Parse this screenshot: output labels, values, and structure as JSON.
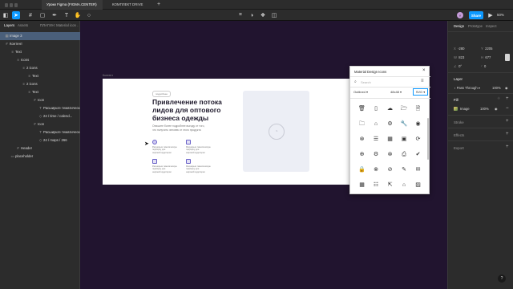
{
  "tabs": {
    "home_icon": "home-icon",
    "tab1": "Уроки Figma (FIGMA.CENTER)",
    "tab2": "КОМПЛЕКТ DRIVE",
    "add": "+"
  },
  "toolbar": {
    "share": "Share",
    "zoom": "50%",
    "avatar": "Y",
    "play_icon": "play-icon"
  },
  "left_panel": {
    "tab_layers": "Layers",
    "tab_assets": "Assets",
    "tab_page": "ПЛАГИН: Material icon ...",
    "layers": [
      {
        "label": "Image 3",
        "indent": 0,
        "icon": "▦",
        "selected": true
      },
      {
        "label": "Контент",
        "indent": 0,
        "icon": "#",
        "selected": false
      },
      {
        "label": "Text",
        "indent": 1,
        "icon": "≡",
        "selected": false
      },
      {
        "label": "Icons",
        "indent": 2,
        "icon": "≡",
        "selected": false
      },
      {
        "label": "2 icons",
        "indent": 3,
        "icon": "≡",
        "selected": false
      },
      {
        "label": "Text",
        "indent": 4,
        "icon": "≡",
        "selected": false
      },
      {
        "label": "2 icons",
        "indent": 3,
        "icon": "≡",
        "selected": false
      },
      {
        "label": "Text",
        "indent": 4,
        "icon": "≡",
        "selected": false
      },
      {
        "label": "Icon",
        "indent": 5,
        "icon": "#",
        "selected": false
      },
      {
        "label": "Расширьте тематическ...",
        "indent": 6,
        "icon": "T",
        "selected": false
      },
      {
        "label": "24 / time / calend...",
        "indent": 6,
        "icon": "◇",
        "selected": false
      },
      {
        "label": "Icon",
        "indent": 5,
        "icon": "#",
        "selected": false
      },
      {
        "label": "Расширьте тематическ...",
        "indent": 6,
        "icon": "T",
        "selected": false
      },
      {
        "label": "24 / maps / 266",
        "indent": 6,
        "icon": "◇",
        "selected": false
      },
      {
        "label": "Header",
        "indent": 2,
        "icon": "#",
        "selected": false
      },
      {
        "label": "placeholder",
        "indent": 1,
        "icon": "▭",
        "selected": false
      }
    ]
  },
  "frame": {
    "label": "Контент",
    "badge": "подробнее",
    "headline_1": "Привлечение потока",
    "headline_2": "лидов для оптового",
    "headline_3": "бизнеса одежды",
    "desc_1": "Опишите более подробнее выгоду от того,",
    "desc_2": "что получить человек от этого продукта",
    "features": [
      {
        "text": "Расширьте тематическую подборку для",
        "text2": "широкой аудитории"
      },
      {
        "text": "Расширьте тематическую подборку для",
        "text2": "широкой аудитории"
      },
      {
        "text": "Расширьте тематическую подборку для",
        "text2": "широкой аудитории"
      },
      {
        "text": "Расширьте тематическую подборку для",
        "text2": "широкой аудитории"
      }
    ]
  },
  "plugin": {
    "title": "Material Design Icons",
    "search_placeholder": "Search",
    "style": "Outlined",
    "size": "48x48",
    "format": "SVG",
    "icons": [
      [
        "delete",
        "phone-iphone",
        "cloud-upload",
        "folder-open",
        "description"
      ],
      [
        "folder",
        "home",
        "settings",
        "build",
        "album"
      ],
      [
        "cancel",
        "view-agenda",
        "domain",
        "payments",
        "cached"
      ],
      [
        "add-circle",
        "settings",
        "cancel",
        "local-printshop",
        "check-circle"
      ],
      [
        "lock",
        "cancel",
        "highlight-off",
        "rate-review",
        "mail"
      ],
      [
        "domain",
        "view-list",
        "open-in-new",
        "home",
        "photo"
      ]
    ]
  },
  "right_panel": {
    "tab_design": "Design",
    "tab_prototype": "Prototype",
    "tab_inspect": "Inspect",
    "x": "-280",
    "y": "2205",
    "w": "823",
    "h": "677",
    "r": "0°",
    "c": "0",
    "layer": "Layer",
    "blend": "Pass Through",
    "opacity": "100%",
    "fill": "Fill",
    "fill_name": "Image",
    "fill_opacity": "100%",
    "stroke": "Stroke",
    "effects": "Effects",
    "export": "Export"
  },
  "help": "?",
  "colors": {
    "canvas": "#21142f",
    "accent": "#0d99ff",
    "panel": "#2c2c2c",
    "selected_layer": "#4a5f7a",
    "feature_icon": "#6b63c9"
  }
}
